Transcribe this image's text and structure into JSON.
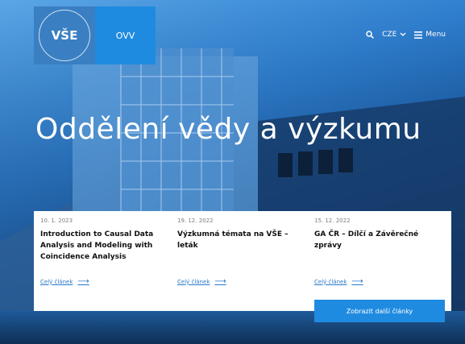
{
  "logo": {
    "text": "VŠE",
    "ring_text": "VYSOKÁ ŠKOLA EKONOMICKÁ V PRAZE"
  },
  "header": {
    "tab_label": "OVV",
    "language": "CZE",
    "menu_label": "Menu"
  },
  "hero": {
    "title": "Oddělení vědy a výzkumu"
  },
  "articles": [
    {
      "date": "10. 1. 2023",
      "title": "Introduction to Causal Data Analysis and Modeling with Coincidence Analysis",
      "link": "Celý článek"
    },
    {
      "date": "19. 12. 2022",
      "title": "Výzkumná témata na VŠE – leták",
      "link": "Celý článek"
    },
    {
      "date": "15. 12. 2022",
      "title": "GA ČR – Dílčí a Závěrečné zprávy",
      "link": "Celý článek"
    }
  ],
  "more_button": "Zobrazit další články",
  "icons": {
    "search": "search-icon",
    "chevron": "chevron-down-icon",
    "menu": "hamburger-icon",
    "arrow": "arrow-right-icon"
  },
  "colors": {
    "brand_blue": "#1f8be0",
    "logo_bg": "#3a7fc2",
    "link": "#2b78c9"
  }
}
